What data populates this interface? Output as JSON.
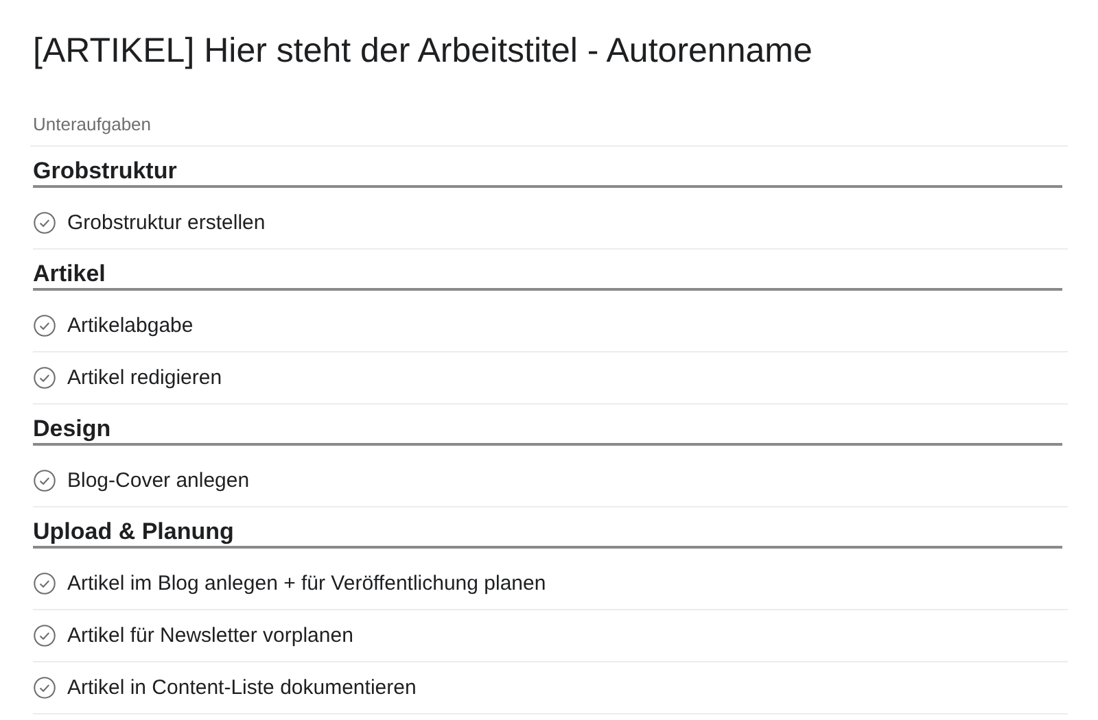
{
  "title": "[ARTIKEL] Hier steht der Arbeitstitel - Autorenname",
  "subtasks_label": "Unteraufgaben",
  "sections": [
    {
      "name": "Grobstruktur",
      "tasks": [
        {
          "name": "Grobstruktur erstellen",
          "completed": false
        }
      ]
    },
    {
      "name": "Artikel",
      "tasks": [
        {
          "name": "Artikelabgabe",
          "completed": false
        },
        {
          "name": "Artikel redigieren",
          "completed": false
        }
      ]
    },
    {
      "name": "Design",
      "tasks": [
        {
          "name": "Blog-Cover anlegen",
          "completed": false
        }
      ]
    },
    {
      "name": "Upload & Planung",
      "tasks": [
        {
          "name": "Artikel im Blog anlegen + für Veröffentlichung planen",
          "completed": false
        },
        {
          "name": "Artikel für Newsletter vorplanen",
          "completed": false
        },
        {
          "name": "Artikel in Content-Liste dokumentieren",
          "completed": false
        }
      ]
    }
  ]
}
